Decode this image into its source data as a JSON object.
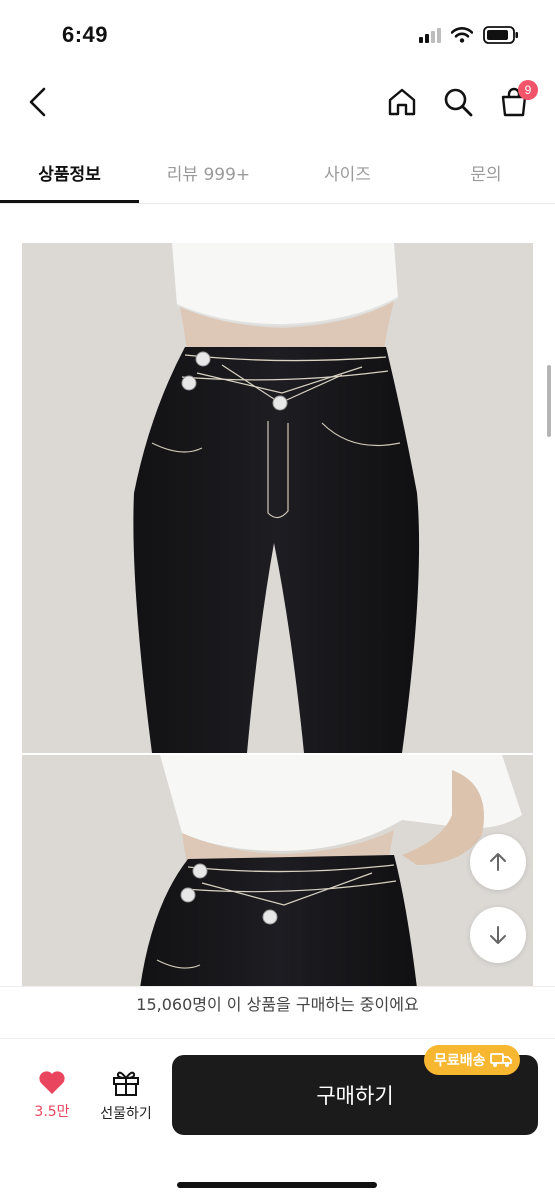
{
  "status_bar": {
    "time": "6:49"
  },
  "nav": {
    "cart_count": "9"
  },
  "tabs": [
    {
      "label": "상품정보"
    },
    {
      "label": "리뷰 999+"
    },
    {
      "label": "사이즈"
    },
    {
      "label": "문의"
    }
  ],
  "active_tab": "상품정보",
  "content": {
    "images": [
      "product-photo-jeans-front",
      "product-photo-jeans-waist-detail"
    ]
  },
  "purchase_notice": "15,060명이 이 상품을 구매하는 중이에요",
  "bottom_bar": {
    "like_count": "3.5만",
    "gift_label": "선물하기",
    "buy_label": "구매하기",
    "free_shipping_label": "무료배송"
  },
  "colors": {
    "accent_red": "#e9455f",
    "badge_pink": "#f2546a",
    "free_ship_yellow": "#f7b731",
    "buy_button": "#1b1b1b"
  },
  "icons": [
    "back-icon",
    "home-icon",
    "search-icon",
    "shopping-bag-icon",
    "arrow-up-icon",
    "arrow-down-icon",
    "heart-icon",
    "gift-icon",
    "truck-icon"
  ]
}
